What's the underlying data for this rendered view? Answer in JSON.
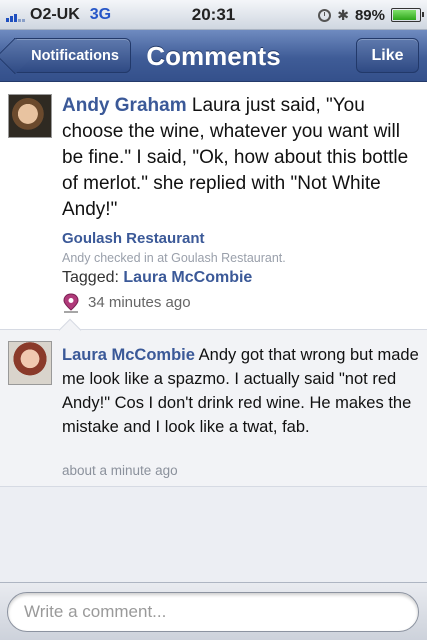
{
  "status_bar": {
    "carrier": "O2-UK",
    "network": "3G",
    "time": "20:31",
    "battery_percent": "89%",
    "battery_level": 0.89
  },
  "nav": {
    "back_label": "Notifications",
    "title": "Comments",
    "like_label": "Like"
  },
  "post": {
    "author": "Andy Graham",
    "message": "Laura just said, \"You choose the wine, whatever you want will be fine.\" I said, \"Ok, how about this bottle of merlot.\" she replied with \"Not White Andy!\"",
    "place": "Goulash Restaurant",
    "checkin": "Andy checked in at Goulash Restaurant.",
    "tagged_label": "Tagged:",
    "tagged_name": "Laura McCombie",
    "time": "34 minutes ago"
  },
  "comments": [
    {
      "author": "Laura McCombie",
      "message": "Andy got that wrong but made me look like a spazmo. I actually said \"not red Andy!\" Cos I don't drink red wine. He makes the mistake and I look like a twat, fab.",
      "time": "about a minute ago"
    }
  ],
  "composer": {
    "placeholder": "Write a comment..."
  },
  "colors": {
    "nav_blue": "#3f5c97",
    "link_blue": "#3b5998",
    "battery_green": "#2da51a"
  }
}
